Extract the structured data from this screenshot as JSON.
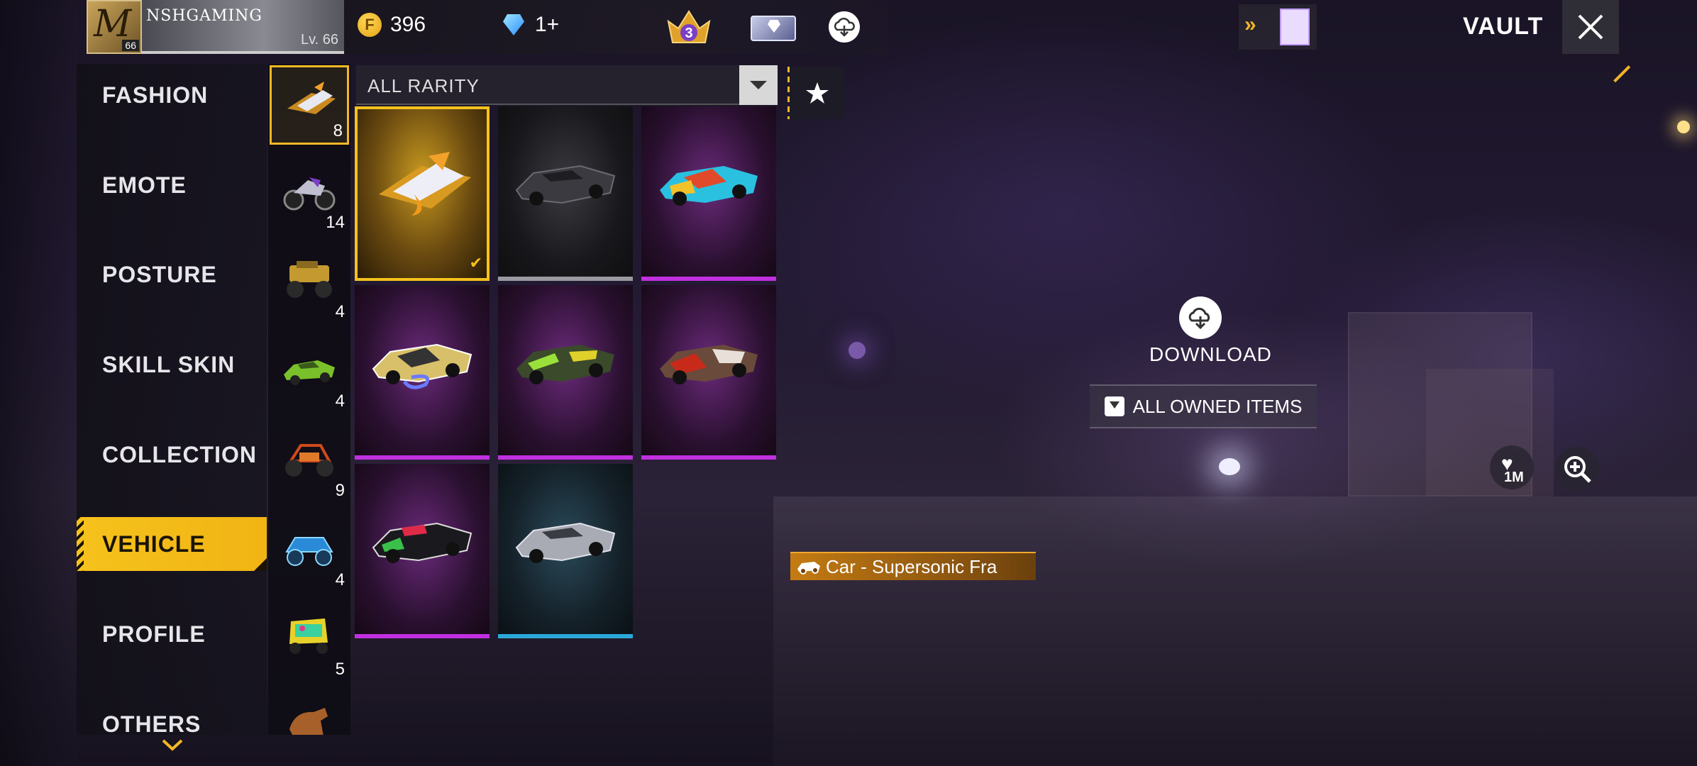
{
  "player": {
    "name": "NSHGAMING",
    "level_text": "Lv. 66",
    "avatar_level": "66"
  },
  "currency": {
    "gold": "396",
    "diamonds": "1+"
  },
  "rank_badge": "3",
  "header": {
    "title": "VAULT"
  },
  "categories": [
    {
      "label": "FASHION",
      "active": false
    },
    {
      "label": "EMOTE",
      "active": false
    },
    {
      "label": "POSTURE",
      "active": false
    },
    {
      "label": "SKILL SKIN",
      "active": false
    },
    {
      "label": "COLLECTION",
      "active": false
    },
    {
      "label": "VEHICLE",
      "active": true
    },
    {
      "label": "PROFILE",
      "active": false
    },
    {
      "label": "OTHERS",
      "active": false
    }
  ],
  "subcategories": [
    {
      "icon": "hoverboard-icon",
      "count": "8",
      "active": true
    },
    {
      "icon": "motorbike-icon",
      "count": "14",
      "active": false
    },
    {
      "icon": "monster-truck-icon",
      "count": "4",
      "active": false
    },
    {
      "icon": "sports-car-icon",
      "count": "4",
      "active": false
    },
    {
      "icon": "buggy-icon",
      "count": "9",
      "active": false
    },
    {
      "icon": "jeep-icon",
      "count": "4",
      "active": false
    },
    {
      "icon": "tuk-tuk-icon",
      "count": "5",
      "active": false
    },
    {
      "icon": "horse-icon",
      "count": "",
      "active": false
    }
  ],
  "filter": {
    "rarity_label": "ALL RARITY"
  },
  "items": [
    {
      "name": "supersonic-fra-car",
      "rarity": "gold",
      "equipped": true
    },
    {
      "name": "grey-convertible",
      "rarity": "grey",
      "equipped": false
    },
    {
      "name": "neon-graffiti-convertible",
      "rarity": "purple",
      "equipped": false
    },
    {
      "name": "gold-s-convertible",
      "rarity": "purple",
      "equipped": false
    },
    {
      "name": "camo-z-convertible",
      "rarity": "purple",
      "equipped": false
    },
    {
      "name": "red-brown-convertible",
      "rarity": "purple",
      "equipped": false
    },
    {
      "name": "black-graffiti-convertible",
      "rarity": "purple",
      "equipped": false
    },
    {
      "name": "silver-convertible",
      "rarity": "teal",
      "equipped": false
    }
  ],
  "colors": {
    "accent": "#f6c21c",
    "purple_rarity": "#c030e0",
    "grey_rarity": "#9a9aa0",
    "teal_rarity": "#2aa8d8"
  },
  "preview": {
    "download_label": "DOWNLOAD",
    "owned_items_label": "ALL OWNED ITEMS",
    "likes": "1M",
    "selected_item_name": "Car - Supersonic Fra"
  }
}
